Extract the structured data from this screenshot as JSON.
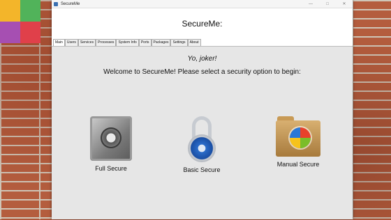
{
  "window": {
    "title": "SecureMe",
    "controls": [
      "—",
      "□",
      "✕"
    ]
  },
  "header": {
    "title": "SecureMe:"
  },
  "tabs": [
    {
      "label": "Main"
    },
    {
      "label": "Users"
    },
    {
      "label": "Services"
    },
    {
      "label": "Processes"
    },
    {
      "label": "System Info"
    },
    {
      "label": "Ports"
    },
    {
      "label": "Packages"
    },
    {
      "label": "Settings"
    },
    {
      "label": "About"
    }
  ],
  "main": {
    "greeting": "Yo, joker!",
    "welcome": "Welcome to SecureMe! Please select a security option to begin:",
    "options": [
      {
        "label": "Full Secure",
        "icon": "safe-icon"
      },
      {
        "label": "Basic Secure",
        "icon": "padlock-icon"
      },
      {
        "label": "Manual Secure",
        "icon": "folder-windows-icon"
      }
    ]
  }
}
